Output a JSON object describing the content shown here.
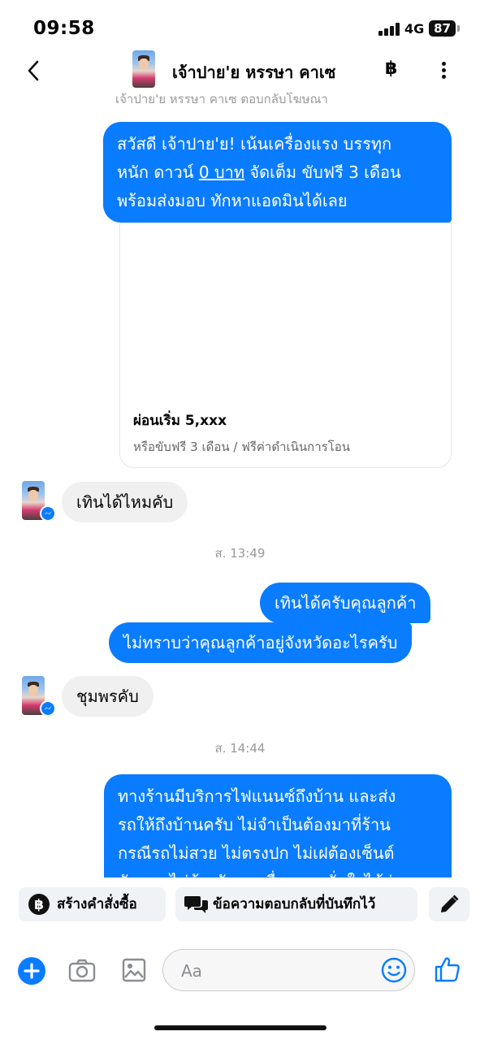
{
  "status_bar": {
    "time": "09:58",
    "network": "4G",
    "battery": "87"
  },
  "header": {
    "contact_name": "เจ้าปาย'ย หรรษา คาเซ",
    "baht_label": "฿",
    "icons": [
      "back-chevron-icon",
      "avatar",
      "baht-icon",
      "more-vertical-icon"
    ]
  },
  "chat": {
    "reply_note": "เจ้าปาย'ย หรรษา คาเซ ตอบกลับโฆษณา",
    "ad_message": {
      "line1": "สวัสดี เจ้าปาย'ย! เน้นเครื่องแรง บรรทุก",
      "line2_pre": "หนัก ดาวน์ ",
      "line2_link": "0 บาท",
      "line2_post": " จัดเต็ม ขับฟรี 3 เดือน",
      "line3": "พร้อมส่งมอบ ทักหาแอดมินได้เลย"
    },
    "ad_card": {
      "title": "ผ่อนเริ่ม 5,xxx",
      "subtitle": "หรือขับฟรี 3 เดือน / ฟรีค่าดำเนินการโอน"
    },
    "incoming_1": "เทินได้ไหมคับ",
    "timestamp_1": "ส. 13:49",
    "outgoing_1": "เทินได้ครับคุณลูกค้า",
    "outgoing_2": "ไม่ทราบว่าคุณลูกค้าอยู่จังหวัดอะไรครับ",
    "incoming_2": "ชุมพรคับ",
    "timestamp_2": "ส. 14:44",
    "outgoing_3": {
      "line1": "ทางร้านมีบริการไฟแนนซ์ถึงบ้าน และส่ง",
      "line2": "รถให้ถึงบ้านครับ ไม่จำเป็นต้องมาที่ร้าน",
      "line3": "กรณีรถไม่สวย ไม่ตรงปก ไม่เฝต้องเซ็นต์",
      "line4": "สัญญา ไม่ต้องรับรถ เพื่อความมั่นใจได้ว่า"
    }
  },
  "quick_actions": {
    "create_order": "สร้างคำสั่งซื้อ",
    "saved_replies": "ข้อความตอบกลับที่บันทึกไว้"
  },
  "composer": {
    "placeholder": "Aa"
  },
  "colors": {
    "accent": "#0a7cff",
    "incoming_bubble": "#f0f0f0",
    "muted_text": "#9a9a9a"
  }
}
